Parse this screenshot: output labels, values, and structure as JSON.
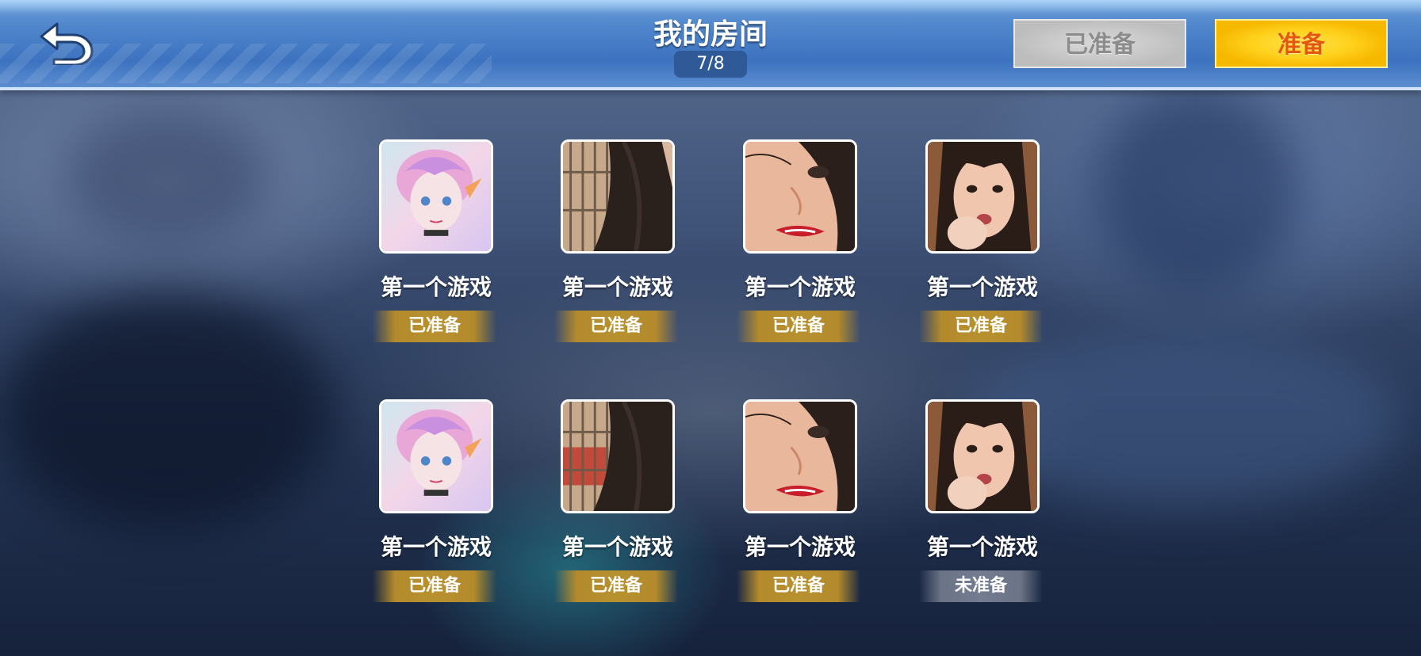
{
  "header": {
    "title": "我的房间",
    "room_count": "7/8",
    "btn_already_ready": "已准备",
    "btn_ready": "准备",
    "back_icon": "back-arrow-icon"
  },
  "players": [
    {
      "name": "第一个游戏",
      "status": "已准备",
      "avatar": "anime-girl-avatar"
    },
    {
      "name": "第一个游戏",
      "status": "已准备",
      "avatar": "hair-window-avatar"
    },
    {
      "name": "第一个游戏",
      "status": "已准备",
      "avatar": "face-closeup-avatar"
    },
    {
      "name": "第一个游戏",
      "status": "已准备",
      "avatar": "girl-eating-avatar"
    },
    {
      "name": "第一个游戏",
      "status": "已准备",
      "avatar": "anime-girl-avatar"
    },
    {
      "name": "第一个游戏",
      "status": "已准备",
      "avatar": "hair-window-avatar"
    },
    {
      "name": "第一个游戏",
      "status": "已准备",
      "avatar": "face-closeup-avatar"
    },
    {
      "name": "第一个游戏",
      "status": "未准备",
      "avatar": "girl-eating-avatar"
    }
  ],
  "colors": {
    "ready_gold": "#b8912f",
    "not_ready_gray": "#737c90",
    "ready_button_yellow": "#ffd21e",
    "ready_button_text": "#e2580f",
    "header_blue": "#3c72bf"
  }
}
